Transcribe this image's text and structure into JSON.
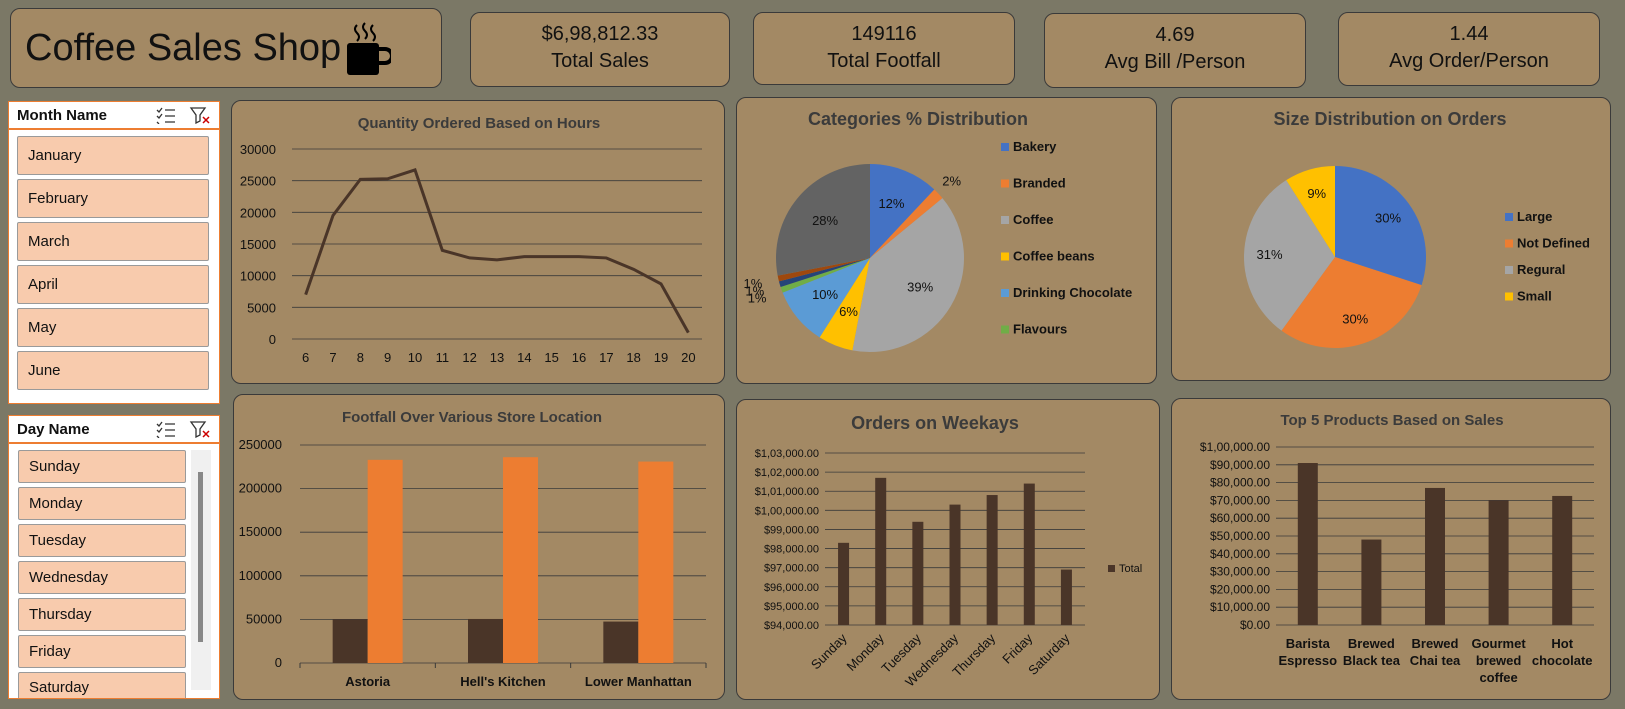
{
  "header": {
    "title": "Coffee Sales Shop",
    "icon": "coffee-cup-icon"
  },
  "kpis": [
    {
      "value": "$6,98,812.33",
      "label": "Total Sales"
    },
    {
      "value": "149116",
      "label": "Total Footfall"
    },
    {
      "value": "4.69",
      "label": "Avg Bill /Person"
    },
    {
      "value": "1.44",
      "label": "Avg Order/Person"
    }
  ],
  "month_slicer": {
    "title": "Month Name",
    "items": [
      "January",
      "February",
      "March",
      "April",
      "May",
      "June"
    ]
  },
  "day_slicer": {
    "title": "Day Name",
    "items": [
      "Sunday",
      "Monday",
      "Tuesday",
      "Wednesday",
      "Thursday",
      "Friday",
      "Saturday"
    ]
  },
  "colors": {
    "dark": "#4a3528",
    "orange": "#ed7d31",
    "blue": "#4472c4",
    "gray": "#a5a5a5",
    "gold": "#ffc000",
    "lightblue": "#5b9bd5",
    "green": "#70ad47",
    "navy": "#264478",
    "darkgray": "#636363",
    "brown": "#9e480e"
  },
  "chart_data": [
    {
      "id": "hours",
      "type": "line",
      "title": "Quantity Ordered Based on Hours",
      "x": [
        6,
        7,
        8,
        9,
        10,
        11,
        12,
        13,
        14,
        15,
        16,
        17,
        18,
        19,
        20
      ],
      "values": [
        7000,
        19500,
        25200,
        25300,
        26700,
        14000,
        12800,
        12500,
        13000,
        13000,
        13000,
        12800,
        11000,
        8700,
        1000
      ],
      "ylim": [
        0,
        30000
      ],
      "yticks": [
        "30000",
        "25000",
        "20000",
        "15000",
        "10000",
        "5000",
        "0"
      ]
    },
    {
      "id": "categories",
      "type": "pie",
      "title": "Categories % Distribution",
      "slices": [
        {
          "name": "Bakery",
          "value": 12,
          "label": "12%"
        },
        {
          "name": "Branded",
          "value": 2,
          "label": "2%"
        },
        {
          "name": "Coffee",
          "value": 39,
          "label": "39%"
        },
        {
          "name": "Coffee beans",
          "value": 6,
          "label": "6%"
        },
        {
          "name": "Drinking Chocolate",
          "value": 10,
          "label": "10%"
        },
        {
          "name": "Flavours",
          "value": 1,
          "label": "1%"
        },
        {
          "name": "",
          "value": 1,
          "label": "1%"
        },
        {
          "name": "",
          "value": 1,
          "label": "1%"
        },
        {
          "name": "",
          "value": 28,
          "label": "28%"
        }
      ],
      "legend": [
        "Bakery",
        "Branded",
        "Coffee",
        "Coffee beans",
        "Drinking Chocolate",
        "Flavours"
      ]
    },
    {
      "id": "sizes",
      "type": "pie",
      "title": "Size Distribution  on Orders",
      "slices": [
        {
          "name": "Large",
          "value": 30,
          "label": "30%"
        },
        {
          "name": "Not Defined",
          "value": 30,
          "label": "30%"
        },
        {
          "name": "Regural",
          "value": 31,
          "label": "31%"
        },
        {
          "name": "Small",
          "value": 9,
          "label": "9%"
        }
      ],
      "legend": [
        "Large",
        "Not Defined",
        "Regural",
        "Small"
      ]
    },
    {
      "id": "footfall",
      "type": "bar",
      "title": "Footfall Over Various Store Location",
      "categories": [
        "Astoria",
        "Hell's Kitchen",
        "Lower Manhattan"
      ],
      "series": [
        {
          "values": [
            50000,
            50500,
            47500
          ]
        },
        {
          "values": [
            233000,
            236000,
            231000
          ]
        }
      ],
      "ylim": [
        0,
        250000
      ],
      "yticks": [
        "250000",
        "200000",
        "150000",
        "100000",
        "50000",
        "0"
      ]
    },
    {
      "id": "weekdays",
      "type": "bar",
      "title": "Orders on Weekays",
      "categories": [
        "Sunday",
        "Monday",
        "Tuesday",
        "Wednesday",
        "Thursday",
        "Friday",
        "Saturday"
      ],
      "series": [
        {
          "name": "Total",
          "values": [
            98300,
            101700,
            99400,
            100300,
            100800,
            101400,
            96900
          ]
        }
      ],
      "ylim": [
        94000,
        103000
      ],
      "yticks": [
        "$1,03,000.00",
        "$1,02,000.00",
        "$1,01,000.00",
        "$1,00,000.00",
        "$99,000.00",
        "$98,000.00",
        "$97,000.00",
        "$96,000.00",
        "$95,000.00",
        "$94,000.00"
      ]
    },
    {
      "id": "products",
      "type": "bar",
      "title": "Top 5 Products Based on Sales",
      "categories": [
        "Barista Espresso",
        "Brewed Black tea",
        "Brewed Chai tea",
        "Gourmet brewed coffee",
        "Hot chocolate"
      ],
      "category_lines": [
        [
          "Barista",
          "Espresso"
        ],
        [
          "Brewed",
          "Black tea"
        ],
        [
          "Brewed",
          "Chai tea"
        ],
        [
          "Gourmet",
          "brewed",
          "coffee"
        ],
        [
          "Hot",
          "chocolate"
        ]
      ],
      "series": [
        {
          "values": [
            91000,
            48000,
            77000,
            70000,
            72500
          ]
        }
      ],
      "ylim": [
        0,
        100000
      ],
      "yticks": [
        "$1,00,000.00",
        "$90,000.00",
        "$80,000.00",
        "$70,000.00",
        "$60,000.00",
        "$50,000.00",
        "$40,000.00",
        "$30,000.00",
        "$20,000.00",
        "$10,000.00",
        "$0.00"
      ]
    }
  ]
}
